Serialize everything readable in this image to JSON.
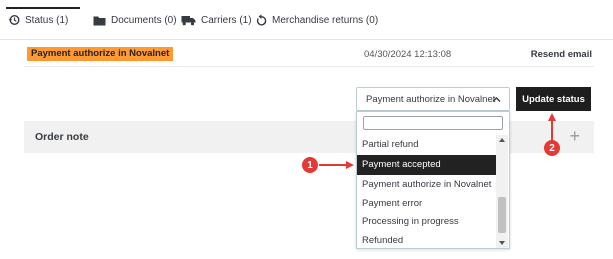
{
  "tabs": [
    {
      "label": "Status (1)",
      "icon": "history-icon"
    },
    {
      "label": "Documents (0)",
      "icon": "folder-icon"
    },
    {
      "label": "Carriers (1)",
      "icon": "truck-icon"
    },
    {
      "label": "Merchandise returns (0)",
      "icon": "return-icon"
    }
  ],
  "history": {
    "status": "Payment authorize in Novalnet",
    "date": "04/30/2024 12:13:08",
    "action": "Resend email"
  },
  "status_select": {
    "value": "Payment authorize in Novalnet",
    "update_label": "Update status"
  },
  "order_note": {
    "title": "Order note",
    "add_icon": "+"
  },
  "dropdown": {
    "items": [
      "Partial refund",
      "Payment accepted",
      "Payment authorize in Novalnet",
      "Payment error",
      "Processing in progress",
      "Refunded"
    ]
  },
  "annotations": {
    "badge_1": "1",
    "badge_2": "2"
  },
  "colors": {
    "status_badge": "#ff9a32",
    "selected_item": "#25b9d7",
    "highlighted_item": "#222222",
    "annotation": "#e53935",
    "button": "#1e1e1e"
  }
}
